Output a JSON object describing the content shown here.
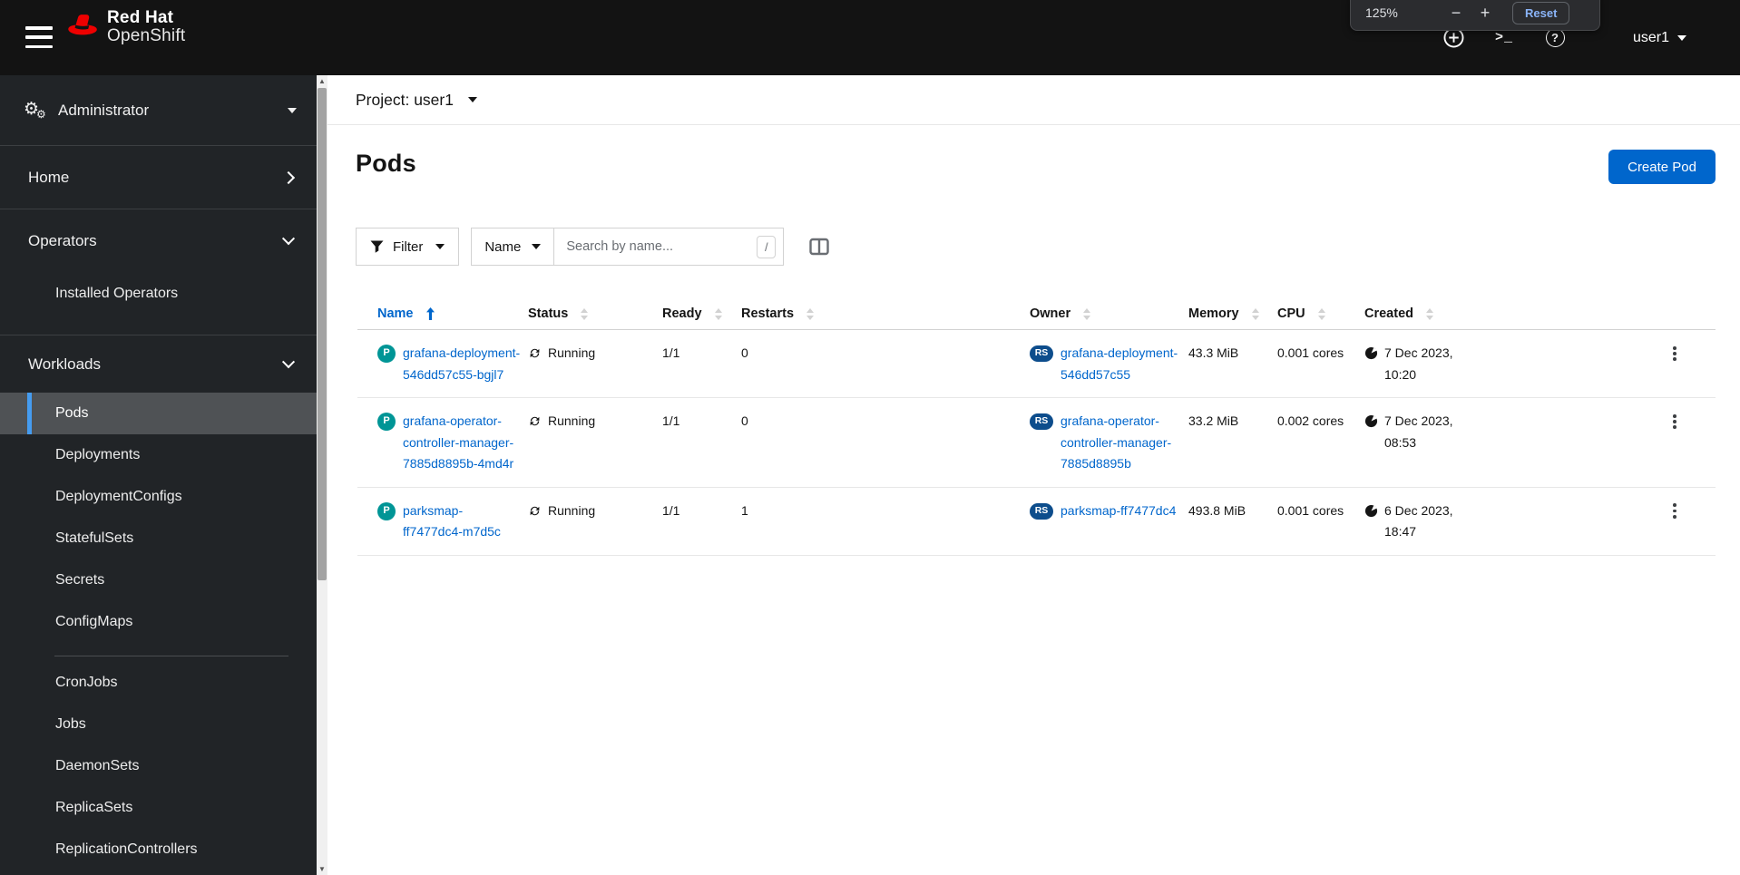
{
  "colors": {
    "masthead_bg": "#131313",
    "sidebar_bg": "#212427",
    "accent_link": "#0066cc",
    "primary_button": "#0066cc",
    "nav_current_bar": "#459cf0",
    "pod_badge": "#009596",
    "owner_badge": "#0d4d8c",
    "reset_link": "#8ab4f8"
  },
  "masthead": {
    "brand_line1": "Red Hat",
    "brand_line2": "OpenShift",
    "username": "user1",
    "icon_glyphs": {
      "terminal": ">_",
      "help": "?"
    }
  },
  "zoom_popup": {
    "level": "125%",
    "minus": "−",
    "plus": "+",
    "reset_label": "Reset"
  },
  "sidebar": {
    "perspective": "Administrator",
    "perspective_icon": "⚙",
    "home_label": "Home",
    "operators_label": "Operators",
    "operators_children": [
      "Installed Operators"
    ],
    "workloads_label": "Workloads",
    "workloads_children": [
      "Pods",
      "Deployments",
      "DeploymentConfigs",
      "StatefulSets",
      "Secrets",
      "ConfigMaps",
      "CronJobs",
      "Jobs",
      "DaemonSets",
      "ReplicaSets",
      "ReplicationControllers"
    ],
    "selected_item": "Pods"
  },
  "project_bar": {
    "label": "Project: user1"
  },
  "page": {
    "title": "Pods",
    "create_button": "Create Pod"
  },
  "toolbar": {
    "filter_label": "Filter",
    "attribute_label": "Name",
    "search_placeholder": "Search by name...",
    "shortcut": "/"
  },
  "table": {
    "columns": [
      "Name",
      "Status",
      "Ready",
      "Restarts",
      "Owner",
      "Memory",
      "CPU",
      "Created"
    ],
    "sorted_column": "Name",
    "sort_direction": "asc",
    "rows": [
      {
        "badge": "P",
        "name": "grafana-deployment-546dd57c55-bgjl7",
        "status": "Running",
        "ready": "1/1",
        "restarts": "0",
        "owner_badge": "RS",
        "owner": "grafana-deployment-546dd57c55",
        "memory": "43.3 MiB",
        "cpu": "0.001 cores",
        "created": "7 Dec 2023, 10:20"
      },
      {
        "badge": "P",
        "name": "grafana-operator-controller-manager-7885d8895b-4md4r",
        "status": "Running",
        "ready": "1/1",
        "restarts": "0",
        "owner_badge": "RS",
        "owner": "grafana-operator-controller-manager-7885d8895b",
        "memory": "33.2 MiB",
        "cpu": "0.002 cores",
        "created": "7 Dec 2023, 08:53"
      },
      {
        "badge": "P",
        "name": "parksmap-ff7477dc4-m7d5c",
        "status": "Running",
        "ready": "1/1",
        "restarts": "1",
        "owner_badge": "RS",
        "owner": "parksmap-ff7477dc4",
        "memory": "493.8 MiB",
        "cpu": "0.001 cores",
        "created": "6 Dec 2023, 18:47"
      }
    ]
  }
}
